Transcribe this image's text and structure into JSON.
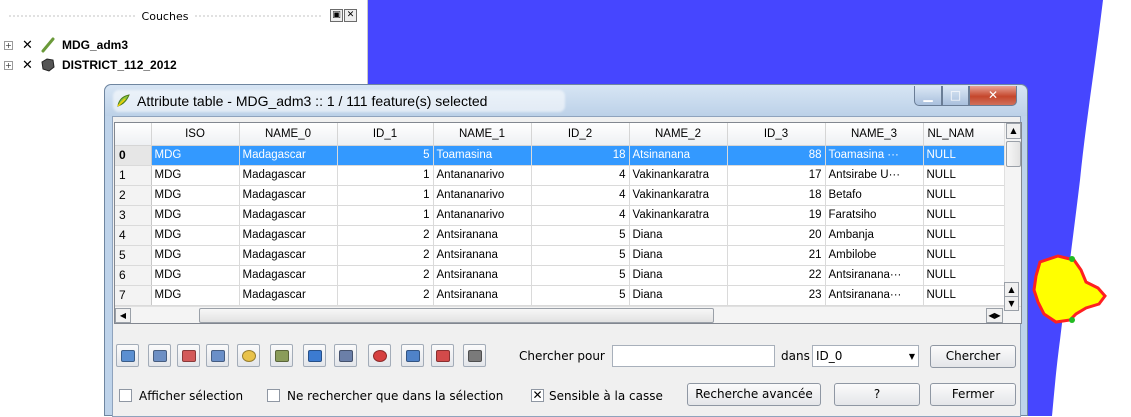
{
  "layers_panel": {
    "title": "Couches",
    "layers": [
      {
        "name": "MDG_adm3",
        "checked": true,
        "icon": "line-layer-icon"
      },
      {
        "name": "DISTRICT_112_2012",
        "checked": true,
        "icon": "polygon-layer-icon"
      }
    ]
  },
  "dialog": {
    "title": "Attribute table - MDG_adm3 :: 1 / 111 feature(s) selected",
    "columns": [
      "ISO",
      "NAME_0",
      "ID_1",
      "NAME_1",
      "ID_2",
      "NAME_2",
      "ID_3",
      "NAME_3",
      "NL_NAM"
    ],
    "rows": [
      {
        "idx": "0",
        "ISO": "MDG",
        "NAME_0": "Madagascar",
        "ID_1": "5",
        "NAME_1": "Toamasina",
        "ID_2": "18",
        "NAME_2": "Atsinanana",
        "ID_3": "88",
        "NAME_3": "Toamasina ···",
        "NL_NAM": "NULL",
        "selected": true
      },
      {
        "idx": "1",
        "ISO": "MDG",
        "NAME_0": "Madagascar",
        "ID_1": "1",
        "NAME_1": "Antananarivo",
        "ID_2": "4",
        "NAME_2": "Vakinankaratra",
        "ID_3": "17",
        "NAME_3": "Antsirabe U···",
        "NL_NAM": "NULL",
        "selected": false
      },
      {
        "idx": "2",
        "ISO": "MDG",
        "NAME_0": "Madagascar",
        "ID_1": "1",
        "NAME_1": "Antananarivo",
        "ID_2": "4",
        "NAME_2": "Vakinankaratra",
        "ID_3": "18",
        "NAME_3": "Betafo",
        "NL_NAM": "NULL",
        "selected": false
      },
      {
        "idx": "3",
        "ISO": "MDG",
        "NAME_0": "Madagascar",
        "ID_1": "1",
        "NAME_1": "Antananarivo",
        "ID_2": "4",
        "NAME_2": "Vakinankaratra",
        "ID_3": "19",
        "NAME_3": "Faratsiho",
        "NL_NAM": "NULL",
        "selected": false
      },
      {
        "idx": "4",
        "ISO": "MDG",
        "NAME_0": "Madagascar",
        "ID_1": "2",
        "NAME_1": "Antsiranana",
        "ID_2": "5",
        "NAME_2": "Diana",
        "ID_3": "20",
        "NAME_3": "Ambanja",
        "NL_NAM": "NULL",
        "selected": false
      },
      {
        "idx": "5",
        "ISO": "MDG",
        "NAME_0": "Madagascar",
        "ID_1": "2",
        "NAME_1": "Antsiranana",
        "ID_2": "5",
        "NAME_2": "Diana",
        "ID_3": "21",
        "NAME_3": "Ambilobe",
        "NL_NAM": "NULL",
        "selected": false
      },
      {
        "idx": "6",
        "ISO": "MDG",
        "NAME_0": "Madagascar",
        "ID_1": "2",
        "NAME_1": "Antsiranana",
        "ID_2": "5",
        "NAME_2": "Diana",
        "ID_3": "22",
        "NAME_3": "Antsiranana···",
        "NL_NAM": "NULL",
        "selected": false
      },
      {
        "idx": "7",
        "ISO": "MDG",
        "NAME_0": "Madagascar",
        "ID_1": "2",
        "NAME_1": "Antsiranana",
        "ID_2": "5",
        "NAME_2": "Diana",
        "ID_3": "23",
        "NAME_3": "Antsiranana···",
        "NL_NAM": "NULL",
        "selected": false
      }
    ],
    "toolbar_icons": [
      "table-icon",
      "invert-selection-icon",
      "select-all-icon",
      "move-selection-top-icon",
      "zoom-to-selection-icon",
      "copy-rows-icon",
      "toggle-edit-icon",
      "save-edits-icon",
      "delete-selected-icon",
      "new-column-icon",
      "delete-column-icon",
      "field-calculator-icon"
    ],
    "search_label": "Chercher pour",
    "search_value": "",
    "in_label": "dans",
    "field_selected": "ID_0",
    "search_button": "Chercher",
    "show_selected_label": "Afficher sélection",
    "search_selected_only_label": "Ne rechercher que dans la sélection",
    "case_sensitive_label": "Sensible à la casse",
    "case_sensitive_checked": true,
    "advanced_button": "Recherche avancée",
    "help_button": "?",
    "close_button": "Fermer"
  },
  "colors": {
    "sea": "#4646ff",
    "selected_feature": "#ffff00",
    "selection_row": "#3399ff"
  }
}
